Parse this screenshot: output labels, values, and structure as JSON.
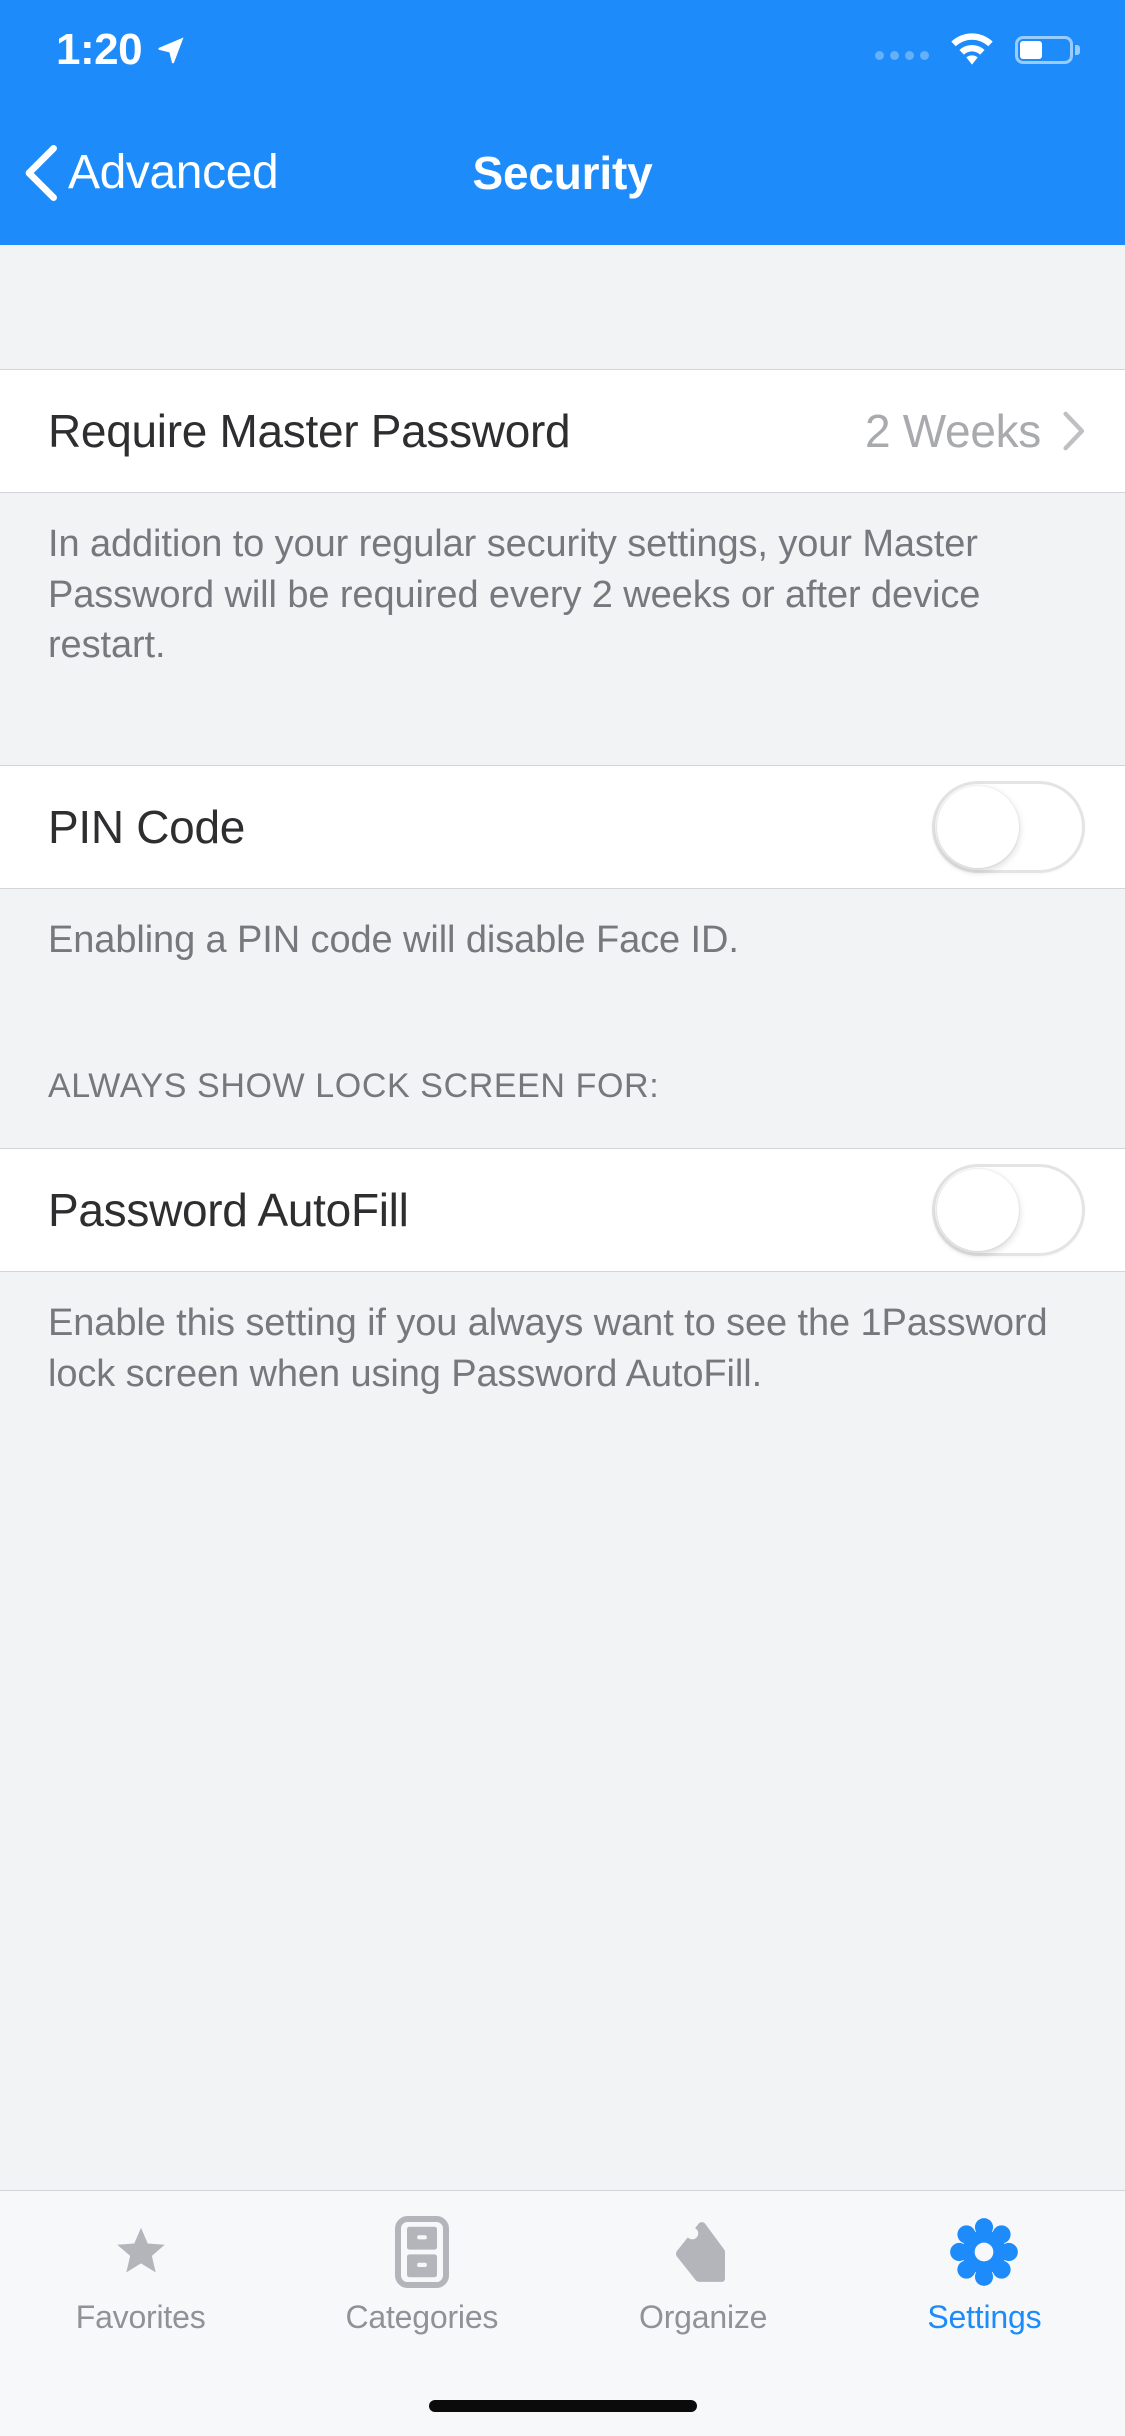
{
  "status_bar": {
    "time": "1:20",
    "location_icon": "location-arrow-icon",
    "signal_icon": "signal-dots-icon",
    "wifi_icon": "wifi-icon",
    "battery_icon": "battery-icon"
  },
  "navbar": {
    "back_label": "Advanced",
    "back_icon": "chevron-left-icon",
    "title": "Security",
    "accent_color": "#1d8cfa"
  },
  "sections": [
    {
      "rows": [
        {
          "label": "Require Master Password",
          "value": "2 Weeks",
          "accessory": "chevron-right-icon"
        }
      ],
      "footer": "In addition to your regular security settings, your Master Password will be required every 2 weeks or after device restart."
    },
    {
      "rows": [
        {
          "label": "PIN Code",
          "toggle": "off"
        }
      ],
      "footer": "Enabling a PIN code will disable Face ID."
    },
    {
      "header": "ALWAYS SHOW LOCK SCREEN FOR:",
      "rows": [
        {
          "label": "Password AutoFill",
          "toggle": "off"
        }
      ],
      "footer": "Enable this setting if you always want to see the 1Password lock screen when using Password AutoFill."
    }
  ],
  "tabbar": {
    "items": [
      {
        "label": "Favorites",
        "icon": "star-icon",
        "active": false
      },
      {
        "label": "Categories",
        "icon": "filing-cabinet-icon",
        "active": false
      },
      {
        "label": "Organize",
        "icon": "tag-icon",
        "active": false
      },
      {
        "label": "Settings",
        "icon": "gear-icon",
        "active": true
      }
    ],
    "active_color": "#1d8cfa",
    "inactive_color": "#b4b5bb"
  }
}
